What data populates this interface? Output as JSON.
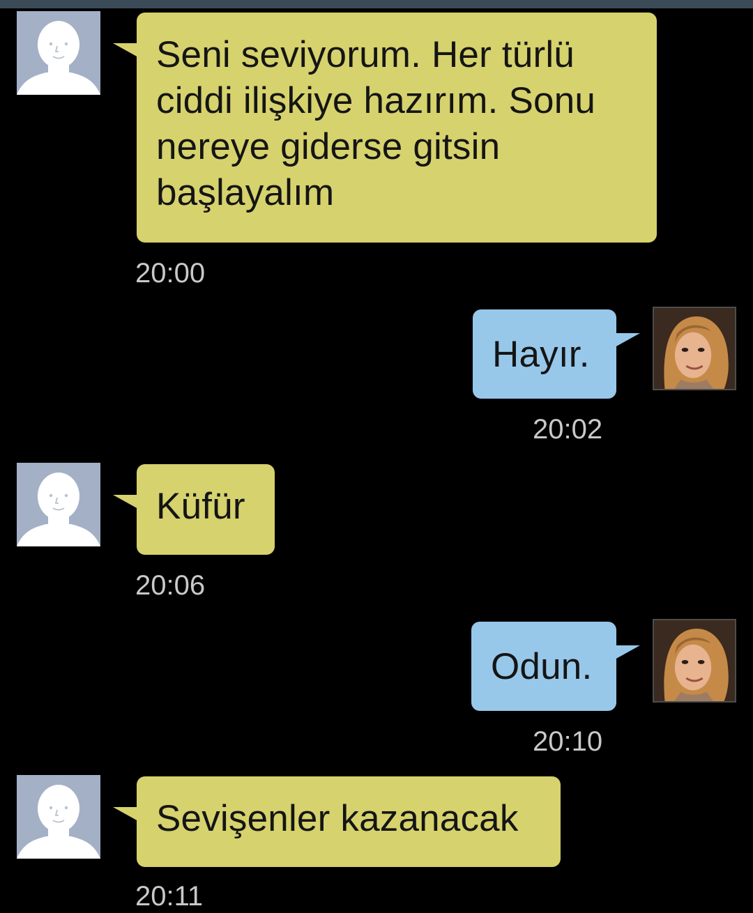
{
  "conversation": {
    "messages": [
      {
        "direction": "incoming",
        "text": "Seni seviyorum. Her türlü\nciddi ilişkiye hazırım. Sonu\nnereye giderse gitsin\nbaşlayalım",
        "time": "20:00",
        "avatar": "default-contact-icon"
      },
      {
        "direction": "outgoing",
        "text": "Hayır.",
        "time": "20:02",
        "avatar": "profile-photo"
      },
      {
        "direction": "incoming",
        "text": "Küfür",
        "time": "20:06",
        "avatar": "default-contact-icon"
      },
      {
        "direction": "outgoing",
        "text": "Odun.",
        "time": "20:10",
        "avatar": "profile-photo"
      },
      {
        "direction": "incoming",
        "text": "Sevişenler kazanacak",
        "time": "20:11",
        "avatar": "default-contact-icon"
      }
    ]
  },
  "colors": {
    "incoming_bubble": "#d6d26d",
    "outgoing_bubble": "#97c8ea",
    "background": "#000000",
    "timestamp": "#c9c9c9"
  }
}
